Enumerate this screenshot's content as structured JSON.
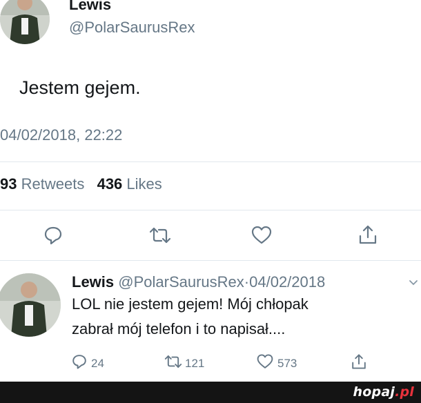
{
  "tweet": {
    "display_name": "Lewis",
    "handle": "@PolarSaurusRex",
    "text": "Jestem gejem.",
    "timestamp": "04/02/2018, 22:22",
    "retweets_count": "93",
    "retweets_label": "Retweets",
    "likes_count": "436",
    "likes_label": "Likes",
    "actions": {
      "reply_icon": "reply-icon",
      "retweet_icon": "retweet-icon",
      "like_icon": "heart-icon",
      "share_icon": "share-icon"
    }
  },
  "reply": {
    "display_name": "Lewis",
    "handle": "@PolarSaurusRex",
    "separator": "·",
    "date": "04/02/2018",
    "text_line1": "LOL nie jestem gejem! Mój chłopak",
    "text_line2": "zabrał mój telefon i to napisał....",
    "reply_count": "24",
    "retweet_count": "121",
    "like_count": "573"
  },
  "watermark": {
    "name": "hopaj",
    "tld": ".pl"
  },
  "colors": {
    "text": "#14171a",
    "secondary": "#657786",
    "divider": "#e1e8ed",
    "footer": "#141414",
    "watermark_accent": "#e8323c"
  }
}
